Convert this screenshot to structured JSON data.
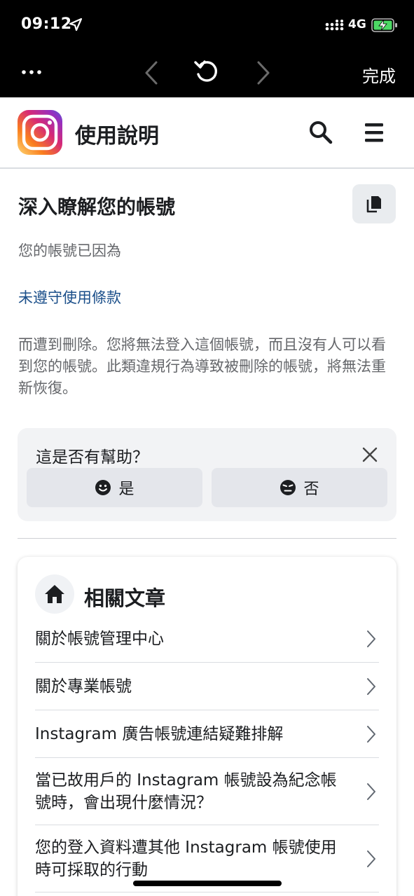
{
  "status_bar": {
    "time": "09:12",
    "network": "4G"
  },
  "browser": {
    "done_label": "完成"
  },
  "header": {
    "title": "使用說明"
  },
  "article": {
    "title": "深入瞭解您的帳號",
    "intro": "您的帳號已因為",
    "reason_link": "未遵守使用條款",
    "body": "而遭到刪除。您將無法登入這個帳號，而且沒有人可以看到您的帳號。此類違規行為導致被刪除的帳號，將無法重新恢復。"
  },
  "feedback": {
    "question": "這是否有幫助？",
    "yes_label": "是",
    "no_label": "否"
  },
  "related": {
    "title": "相關文章",
    "items": [
      {
        "label": "關於帳號管理中心"
      },
      {
        "label": "關於專業帳號"
      },
      {
        "label": "Instagram 廣告帳號連結疑難排解"
      },
      {
        "label": "當已故用戶的 Instagram 帳號設為紀念帳號時，會出現什麼情況？"
      },
      {
        "label": "您的登入資料遭其他 Instagram 帳號使用時可採取的行動"
      }
    ]
  },
  "colors": {
    "link": "#1b4f8a",
    "muted_text": "#65676b",
    "card_bg": "#f2f3f5"
  }
}
